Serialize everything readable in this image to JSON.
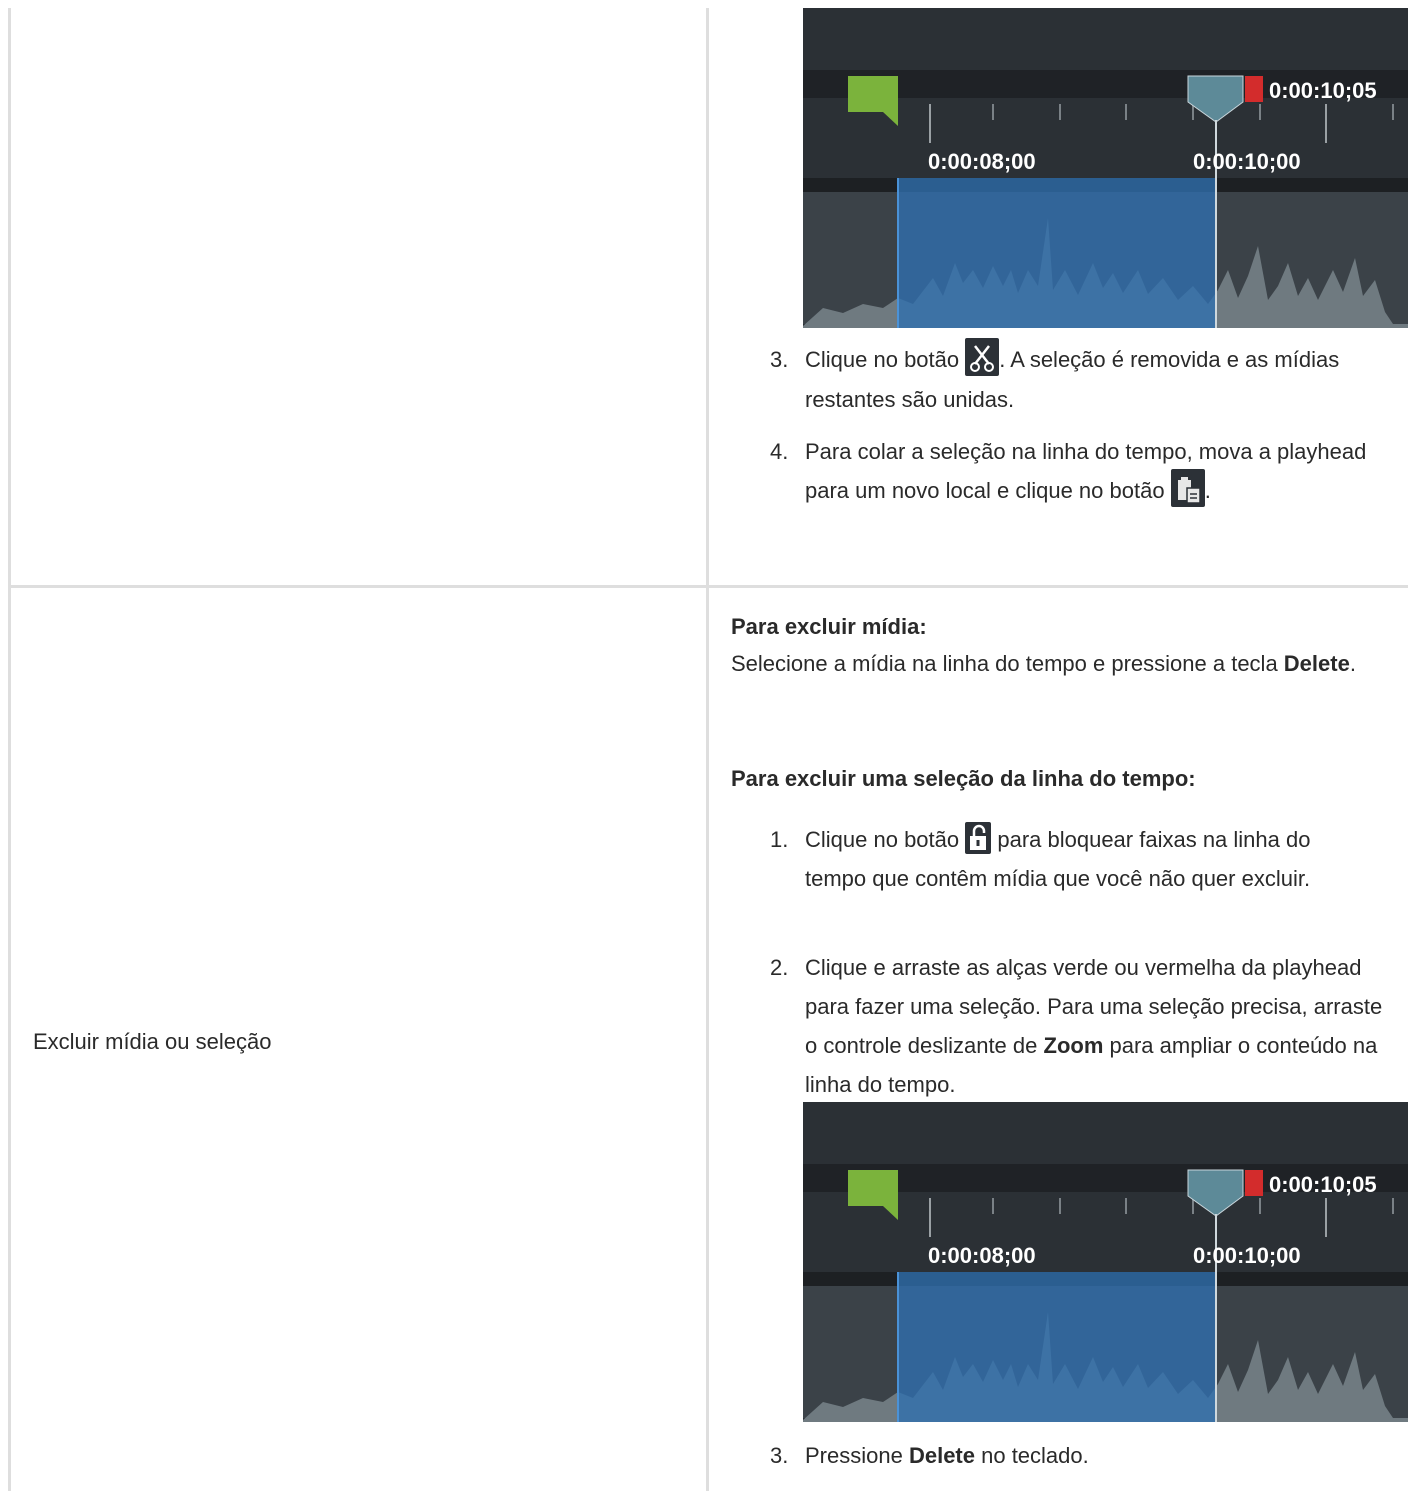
{
  "table": {
    "row1": {
      "timeline": {
        "playhead_time": "0:00:10;05",
        "tick_left": "0:00:08;00",
        "tick_right": "0:00:10;00"
      },
      "steps": [
        {
          "num": "3.",
          "before": "Clique no botão ",
          "icon": "scissors-icon",
          "after": ". A seleção é removida e as mídias restantes são unidas."
        },
        {
          "num": "4.",
          "before": "Para colar a seleção na linha do tempo, mova a playhead para um novo local e clique no botão ",
          "icon": "paste-icon",
          "after": "."
        }
      ]
    },
    "row2": {
      "label": "Excluir mídia ou seleção",
      "heading_media": "Para excluir mídia:",
      "delete_media_text": "Selecione a mídia na linha do tempo e pressione a tecla ",
      "delete_key": "Delete",
      "delete_media_end": ".",
      "heading_selection": "Para excluir uma seleção da linha do tempo:",
      "steps": [
        {
          "num": "1.",
          "before": "Clique no botão ",
          "icon": "unlock-icon",
          "after": " para bloquear faixas na linha do tempo que contêm mídia que você não quer excluir."
        },
        {
          "num": "2.",
          "text": "Clique e arraste as alças verde ou vermelha da playhead para fazer uma seleção. Para uma seleção precisa, arraste o controle deslizante de ",
          "bold": "Zoom",
          "text_end": " para ampliar o conteúdo na linha do tempo."
        },
        {
          "num": "3.",
          "before": "Pressione ",
          "bold": "Delete",
          "after": " no teclado."
        }
      ],
      "timeline": {
        "playhead_time": "0:00:10;05",
        "tick_left": "0:00:08;00",
        "tick_right": "0:00:10;00"
      }
    }
  },
  "colors": {
    "border": "#dedede",
    "timeline_bg": "#2a2e33",
    "selection": "#2f6fb0",
    "start_handle": "#7bb33c",
    "end_handle": "#d32c2c",
    "playhead": "#5d8a98"
  }
}
